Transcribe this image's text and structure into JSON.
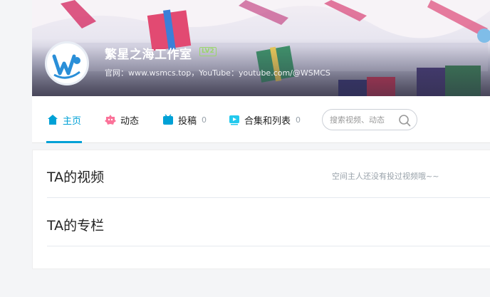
{
  "profile": {
    "name": "繁星之海工作室",
    "level": "LV2",
    "sign": "官网：www.wsmcs.top，YouTube：youtube.com/@WSMCS"
  },
  "nav": {
    "tabs": [
      {
        "label": "主页",
        "icon": "home-icon",
        "count": ""
      },
      {
        "label": "动态",
        "icon": "dynamic-icon",
        "count": ""
      },
      {
        "label": "投稿",
        "icon": "upload-icon",
        "count": "0"
      },
      {
        "label": "合集和列表",
        "icon": "playlist-icon",
        "count": "0"
      }
    ],
    "active_tab": "主页",
    "search_placeholder": "搜索视频、动态"
  },
  "sections": {
    "videos": {
      "title": "TA的视频",
      "empty_text": "空间主人还没有投过视频哦~~"
    },
    "articles": {
      "title": "TA的专栏"
    }
  },
  "colors": {
    "accent": "#00a1d6",
    "level_badge": "#9ad66b"
  }
}
